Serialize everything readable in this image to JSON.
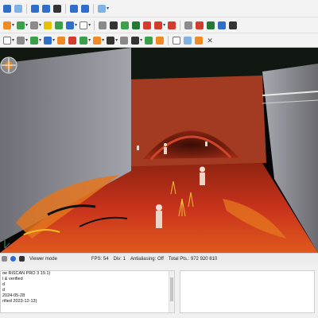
{
  "toolbar": {
    "row1_icons": [
      "grid-icon",
      "edit-icon",
      "save-icon",
      "save-all-icon",
      "back-icon",
      "forward-icon",
      "view-menu-icon"
    ],
    "row2_icons": [
      "object-icon",
      "folder-icon",
      "tools-icon",
      "layers-icon",
      "filter-icon",
      "color-icon",
      "render-icon",
      "clip-icon",
      "settings-icon",
      "pin-icon",
      "target-icon",
      "cube-icon",
      "green-cube-icon",
      "red-cube-icon",
      "axis-icon",
      "rotate-icon",
      "tag-icon",
      "wrench-icon",
      "table-icon",
      "tree-icon",
      "globe-icon",
      "info-icon"
    ],
    "row3_icons": [
      "cloud-icon",
      "triangle-icon",
      "grid-view-icon",
      "palette-icon",
      "scanner-icon",
      "measure-icon",
      "slope-icon",
      "sphere-icon",
      "dot-icon",
      "plane-icon",
      "walk-icon",
      "fly-icon",
      "pan-icon",
      "copy-icon",
      "paste-icon",
      "flag-icon",
      "close-icon"
    ]
  },
  "status": {
    "viewer_mode": "Viewer mode",
    "fps": "FPS: 54",
    "div": "Div: 1",
    "antialiasing": "Antialiasing: Off",
    "total_pts": "Total Pts.: 972 920 810"
  },
  "info_panel": {
    "lines": [
      "oe RiSCAN PRO 3 19.1)",
      "l & verified",
      "d",
      "d",
      "2024-05-28",
      "rified 2023-12-13)"
    ]
  },
  "colors": {
    "point_cloud_hot": "#c8321c",
    "point_cloud_warm": "#e3741f",
    "point_cloud_cool": "#7d7d86",
    "background": "#060606"
  }
}
